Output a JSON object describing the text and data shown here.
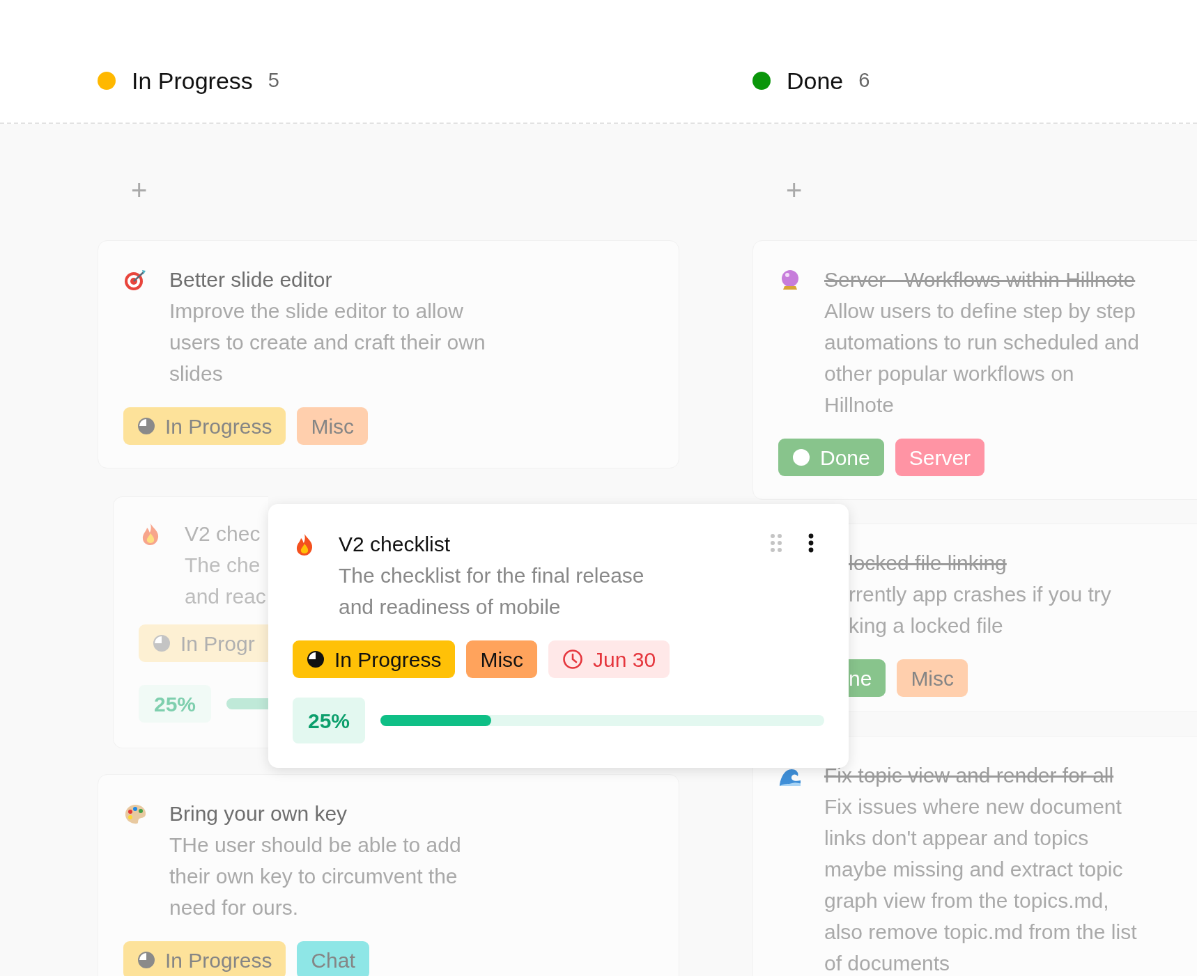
{
  "dragging": true,
  "columns": [
    {
      "title": "In Progress",
      "count": "5",
      "color": "#ffb800",
      "add_label": "+",
      "cards": [
        {
          "kind": "target",
          "title": "Better slide editor",
          "description": "Improve the slide editor to allow\nusers to create and craft their own\nslides",
          "done": false,
          "placeholder": false,
          "tags": [
            {
              "kind": "in-progress",
              "label": "In Progress",
              "color": "#fde29a"
            },
            {
              "kind": "tag",
              "label": "Misc",
              "color": "#ffcfad"
            }
          ]
        },
        {
          "kind": "flame",
          "title": "V2 chec",
          "description": "The che\nand reac",
          "done": false,
          "placeholder": true,
          "tags": [
            {
              "kind": "in-progress",
              "label": "In Progr",
              "color": "#fdf0d3"
            }
          ],
          "progress": {
            "label": "25%"
          }
        },
        {
          "kind": "palette",
          "title": "Bring your own key",
          "description": "THe user should be able to add\ntheir own key to circumvent the\nneed for ours.",
          "done": false,
          "placeholder": false,
          "tags": [
            {
              "kind": "in-progress",
              "label": "In Progress",
              "color": "#fde29a"
            },
            {
              "kind": "tag",
              "label": "Chat",
              "color": "#8ee6e6"
            }
          ]
        }
      ]
    },
    {
      "title": "Done",
      "count": "6",
      "color": "#0a960a",
      "add_label": "+",
      "cards": [
        {
          "kind": "crystal-ball",
          "title": "Server - Workflows within Hillnote",
          "description": "Allow users to define step by step\nautomations to run scheduled and\nother popular workflows on\nHillnote",
          "done": true,
          "placeholder": false,
          "tags": [
            {
              "kind": "done",
              "label": "Done",
              "color": "#88c48c"
            },
            {
              "kind": "tag",
              "label": "Server",
              "color": "#ff94a4"
            }
          ]
        },
        {
          "title": "locked file linking",
          "description": "rrently app crashes if you try\nking a locked file",
          "done": true,
          "placeholder": false,
          "tags": [
            {
              "kind": "done",
              "label": "ne",
              "color": "#88c48c"
            },
            {
              "kind": "tag",
              "label": "Misc",
              "color": "#ffcfad"
            }
          ]
        },
        {
          "kind": "wave",
          "title": "Fix topic view and render for all",
          "description": "Fix issues where new document\nlinks don't appear and topics\nmaybe missing and extract topic\ngraph view from the topics.md,\nalso remove topic.md from the list\nof documents",
          "done": true,
          "placeholder": false
        }
      ]
    }
  ],
  "drag_preview": {
    "kind": "flame",
    "title": "V2 checklist",
    "description": "The checklist for the final release\nand readiness of mobile",
    "done": false,
    "tags": [
      {
        "kind": "in-progress",
        "label": "In Progress",
        "color": "#ffc107"
      },
      {
        "kind": "tag",
        "label": "Misc",
        "color": "#ffa35c"
      },
      {
        "kind": "date",
        "label": "Jun 30"
      }
    ],
    "progress": {
      "label": "25%",
      "level": 0.25
    }
  }
}
